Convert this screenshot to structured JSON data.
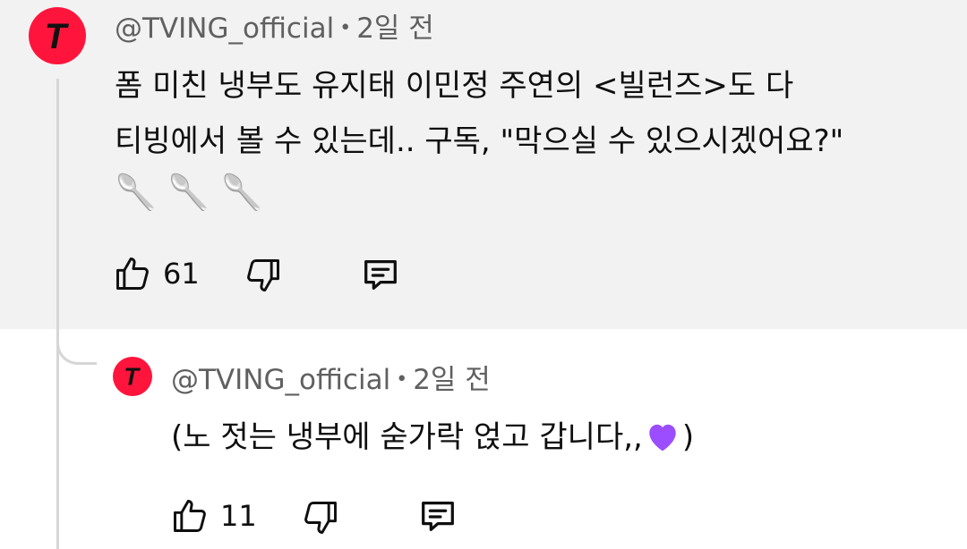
{
  "comment": {
    "author": "@TVING_official",
    "separator": "•",
    "time": "2일 전",
    "line1": "폼 미친 냉부도 유지태 이민정 주연의 <빌런즈>도 다",
    "line2": "티빙에서 볼 수 있는데.. 구독, \"막으실 수 있으시겠어요?\"",
    "emojis": [
      "🥄",
      "🥄",
      "🥄"
    ],
    "like_count": "61",
    "avatar_letter": "T"
  },
  "reply": {
    "author": "@TVING_official",
    "separator": "•",
    "time": "2일 전",
    "text_before": "(노 젓는 냉부에 숟가락 얹고 갑니다,,",
    "emoji": "💜",
    "text_after": ")",
    "like_count": "11",
    "avatar_letter": "T"
  },
  "colors": {
    "brand_red": "#ff153c",
    "top_bg": "#f2f2f2",
    "meta_gray": "#606060",
    "heart_purple": "#9b4dff"
  },
  "icons": {
    "like": "thumbs-up-icon",
    "dislike": "thumbs-down-icon",
    "reply": "comment-icon"
  }
}
